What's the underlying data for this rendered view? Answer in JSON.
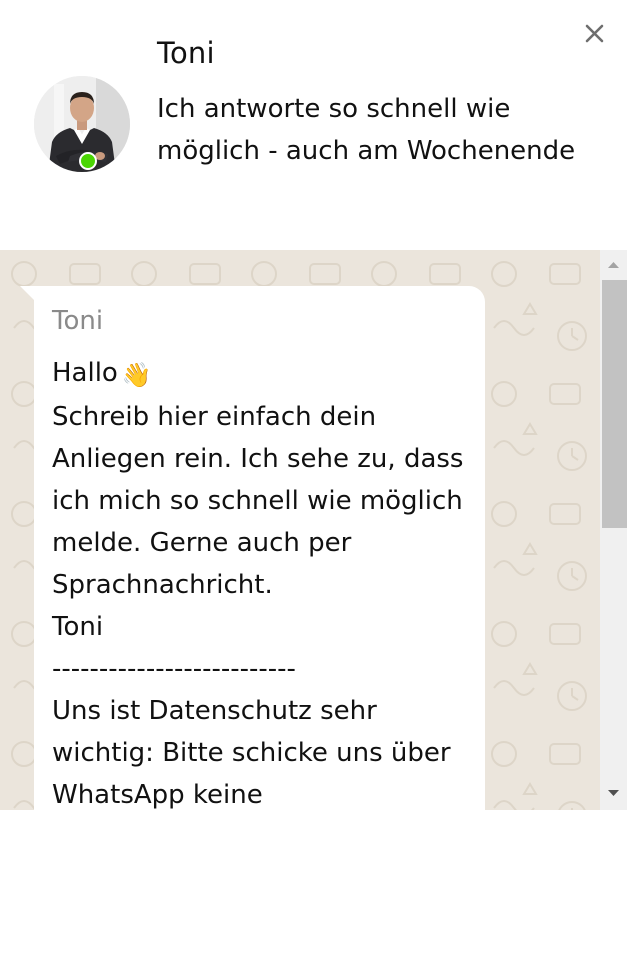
{
  "header": {
    "agent_name": "Toni",
    "status_text": "Ich antworte so schnell wie möglich - auch am Wochenende",
    "online_color": "#4ad504",
    "close_icon": "close-icon"
  },
  "message": {
    "author": "Toni",
    "greeting": "Hallo",
    "greeting_emoji": "👋",
    "body": "Schreib hier einfach dein Anliegen rein. Ich sehe zu, dass ich mich so schnell wie möglich melde. Gerne auch per Sprachnachricht.\nToni\n--------------------------\nUns ist Datenschutz sehr wichtig: Bitte schicke uns über WhatsApp keine"
  },
  "colors": {
    "chat_background": "#ebe5dc",
    "bubble": "#ffffff",
    "author": "#8a8a8a",
    "scrollbar_thumb": "#c2c2c2"
  }
}
